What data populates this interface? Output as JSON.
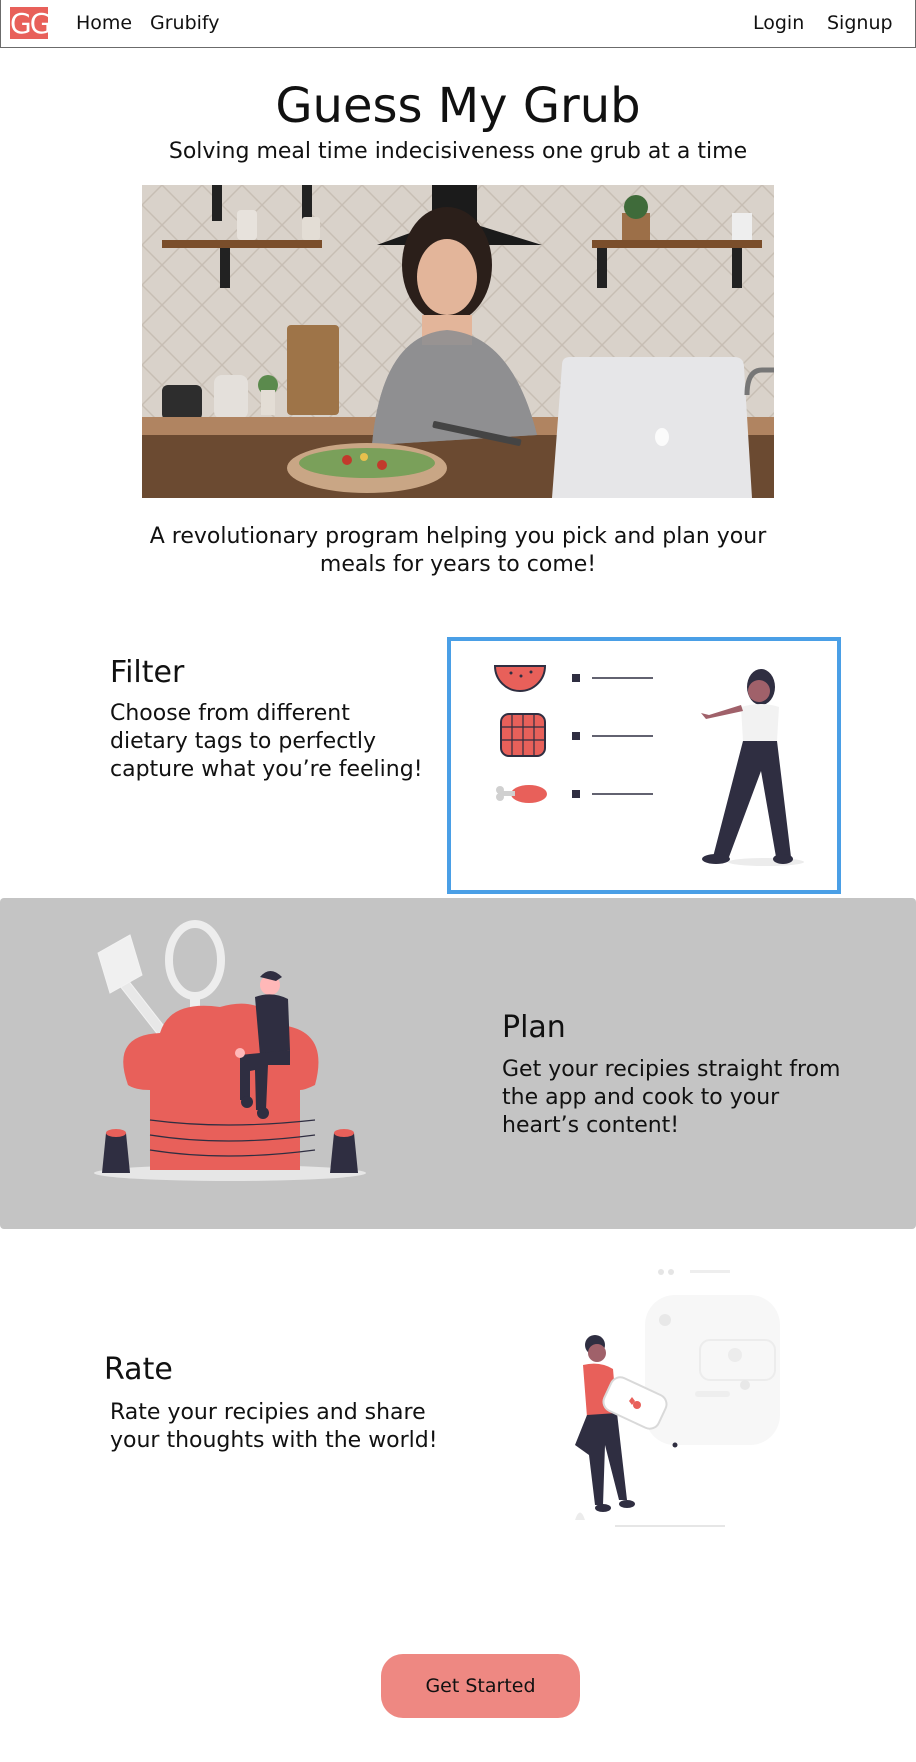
{
  "nav": {
    "logo_text": "GG",
    "links": [
      "Home",
      "Grubify"
    ],
    "login_label": "Login",
    "signup_label": "Signup"
  },
  "hero": {
    "title": "Guess My Grub",
    "subtitle": "Solving meal time indecisiveness one grub at a time",
    "intro": "A revolutionary program helping you pick and plan your meals for years to come!"
  },
  "features": [
    {
      "title": "Filter",
      "text": "Choose from different dietary tags to perfectly capture what you’re feeling!"
    },
    {
      "title": "Plan",
      "text": "Get your recipies straight from the app and cook to your heart’s content!"
    },
    {
      "title": "Rate",
      "text": "Rate your recipies and share your thoughts with the world!"
    }
  ],
  "cta": {
    "label": "Get Started"
  },
  "colors": {
    "accent": "#e8605a",
    "button": "#ee8882",
    "highlight_border": "#4a9fe6",
    "band": "#c4c4c4",
    "ink": "#2f2e41"
  },
  "icons": [
    "logo-icon",
    "hero-photo",
    "filter-illustration",
    "plan-illustration",
    "rate-illustration"
  ]
}
